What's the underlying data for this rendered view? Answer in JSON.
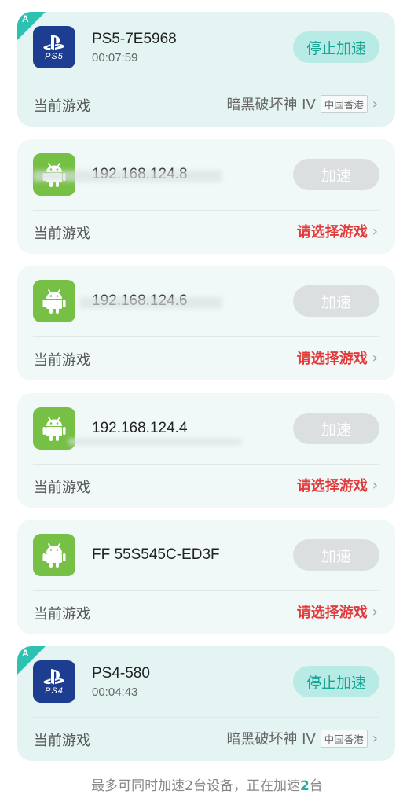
{
  "devices": [
    {
      "badge": "A",
      "platform": "PS5",
      "name": "PS5-7E5968",
      "time": "00:07:59",
      "button": "停止加速",
      "game_label": "当前游戏",
      "game": "暗黑破坏神 IV",
      "region": "中国香港"
    },
    {
      "platform": "Android",
      "name": "192.168.124.8",
      "button": "加速",
      "game_label": "当前游戏",
      "game": "请选择游戏"
    },
    {
      "platform": "Android",
      "name": "192.168.124.6",
      "button": "加速",
      "game_label": "当前游戏",
      "game": "请选择游戏"
    },
    {
      "platform": "Android",
      "name": "192.168.124.4",
      "button": "加速",
      "game_label": "当前游戏",
      "game": "请选择游戏"
    },
    {
      "platform": "Android",
      "name": "FF 55S545C-ED3F",
      "button": "加速",
      "game_label": "当前游戏",
      "game": "请选择游戏"
    },
    {
      "badge": "A",
      "platform": "PS4",
      "name": "PS4-580",
      "time": "00:04:43",
      "button": "停止加速",
      "game_label": "当前游戏",
      "game": "暗黑破坏神 IV",
      "region": "中国香港"
    }
  ],
  "footer": {
    "text_before": "最多可同时加速2台设备，正在加速",
    "count": "2",
    "text_after": "台"
  },
  "colors": {
    "accent": "#2cc1b1",
    "ps_blue": "#1d3d91",
    "android_green": "#76c045",
    "alert_red": "#e23b3b"
  }
}
